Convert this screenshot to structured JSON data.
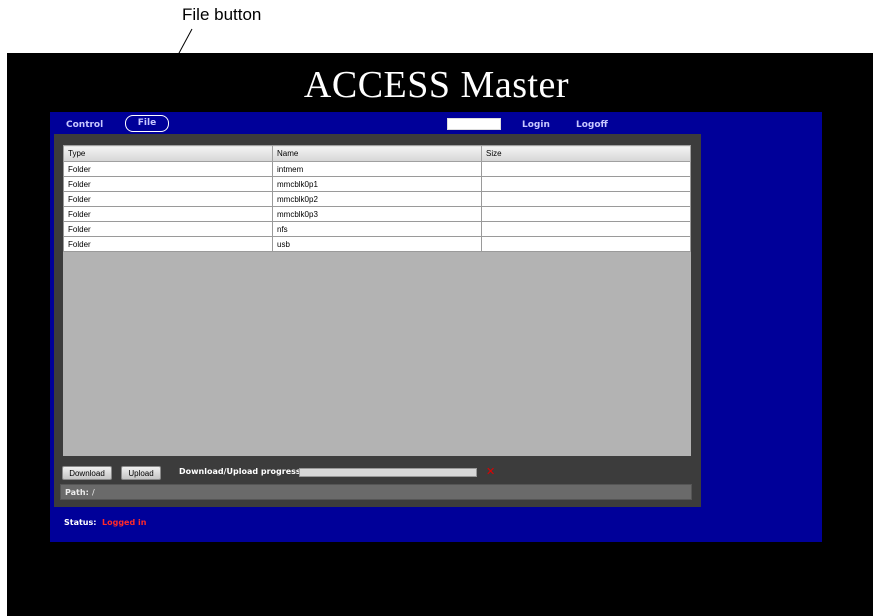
{
  "annotation": {
    "text": "File button"
  },
  "app": {
    "title": "ACCESS Master"
  },
  "nav": {
    "control": "Control",
    "file": "File",
    "login_value": "",
    "login": "Login",
    "logoff": "Logoff"
  },
  "file_table": {
    "headers": [
      "Type",
      "Name",
      "Size"
    ],
    "rows": [
      {
        "type": "Folder",
        "name": "intmem",
        "size": ""
      },
      {
        "type": "Folder",
        "name": "mmcblk0p1",
        "size": ""
      },
      {
        "type": "Folder",
        "name": "mmcblk0p2",
        "size": ""
      },
      {
        "type": "Folder",
        "name": "mmcblk0p3",
        "size": ""
      },
      {
        "type": "Folder",
        "name": "nfs",
        "size": ""
      },
      {
        "type": "Folder",
        "name": "usb",
        "size": ""
      }
    ]
  },
  "transfer": {
    "download_label": "Download",
    "upload_label": "Upload",
    "progress_label": "Download/Upload progress:",
    "progress_fraction": 0,
    "cancel_icon": "x-icon"
  },
  "path": {
    "label": "Path:",
    "value": "/"
  },
  "status": {
    "label": "Status:",
    "value": "Logged in"
  },
  "colors": {
    "panel": "#000099",
    "background": "#000000",
    "status_value": "#ff2a2a",
    "cancel": "#e00000"
  }
}
